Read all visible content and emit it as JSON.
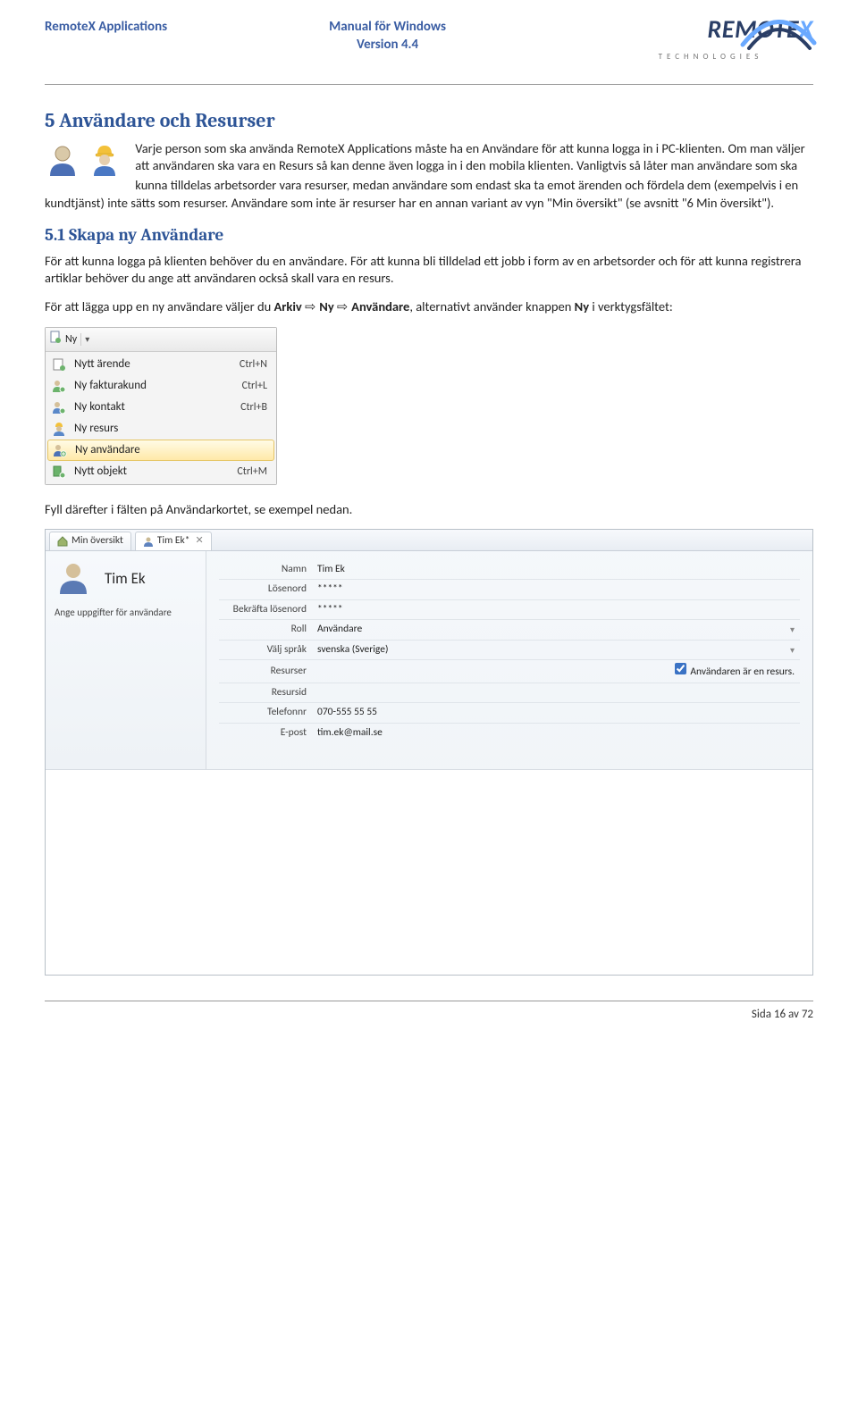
{
  "header": {
    "left": "RemoteX Applications",
    "mid_title": "Manual för Windows",
    "mid_version": "Version 4.4",
    "logo_text": "REMOTE",
    "logo_x": "X",
    "logo_tag": "TECHNOLOGIES"
  },
  "section": {
    "num_title": "5   Användare och Resurser",
    "p1a": "Varje person som ska använda RemoteX Applications måste ha en Användare för att kunna logga in i PC-klienten. Om man väljer att användaren ska vara en Resurs så kan denne även logga in i den mobila klienten. Vanligtvis så låter man användare som ska",
    "p1b": "kunna tilldelas arbetsorder vara resurser, medan användare som endast ska ta emot ärenden och fördela dem (exempelvis i en kundtjänst) inte sätts som resurser. Användare som inte är resurser har en annan variant av vyn \"Min översikt\" (se avsnitt \"6 Min översikt\").",
    "sub_title": "5.1   Skapa ny Användare",
    "p2": "För att kunna logga på klienten behöver du en användare. För att kunna bli tilldelad ett jobb i form av en arbetsorder och för att kunna registrera artiklar behöver du ange att användaren också skall vara en resurs.",
    "p3_a": "För att lägga upp en ny användare väljer du ",
    "p3_arkiv": "Arkiv",
    "p3_ny": "Ny",
    "p3_anv": "Användare",
    "p3_b": ", alternativt använder knappen ",
    "p3_nybtn": "Ny",
    "p3_c": " i verktygsfältet:",
    "p4": "Fyll därefter i fälten på Användarkortet, se exempel nedan."
  },
  "menu": {
    "top_label": "Ny",
    "items": [
      {
        "label": "Nytt ärende",
        "shortcut": "Ctrl+N"
      },
      {
        "label": "Ny fakturakund",
        "shortcut": "Ctrl+L"
      },
      {
        "label": "Ny kontakt",
        "shortcut": "Ctrl+B"
      },
      {
        "label": "Ny resurs",
        "shortcut": ""
      },
      {
        "label": "Ny användare",
        "shortcut": ""
      },
      {
        "label": "Nytt objekt",
        "shortcut": "Ctrl+M"
      }
    ]
  },
  "form": {
    "tab1": "Min översikt",
    "tab2": "Tim Ek*",
    "left_name": "Tim Ek",
    "left_hint": "Ange uppgifter för användare",
    "rows": [
      {
        "label": "Namn",
        "value": "Tim Ek"
      },
      {
        "label": "Lösenord",
        "value": "*****"
      },
      {
        "label": "Bekräfta lösenord",
        "value": "*****"
      },
      {
        "label": "Roll",
        "value": "Användare",
        "dropdown": true
      },
      {
        "label": "Välj språk",
        "value": "svenska (Sverige)",
        "dropdown": true
      },
      {
        "label": "Resurser",
        "value": "",
        "checkbox": true,
        "check_label": "Användaren är en resurs."
      },
      {
        "label": "Resursid",
        "value": ""
      },
      {
        "label": "Telefonnr",
        "value": "070-555 55 55"
      },
      {
        "label": "E-post",
        "value": "tim.ek@mail.se"
      }
    ]
  },
  "footer": {
    "page": "Sida 16 av 72"
  }
}
